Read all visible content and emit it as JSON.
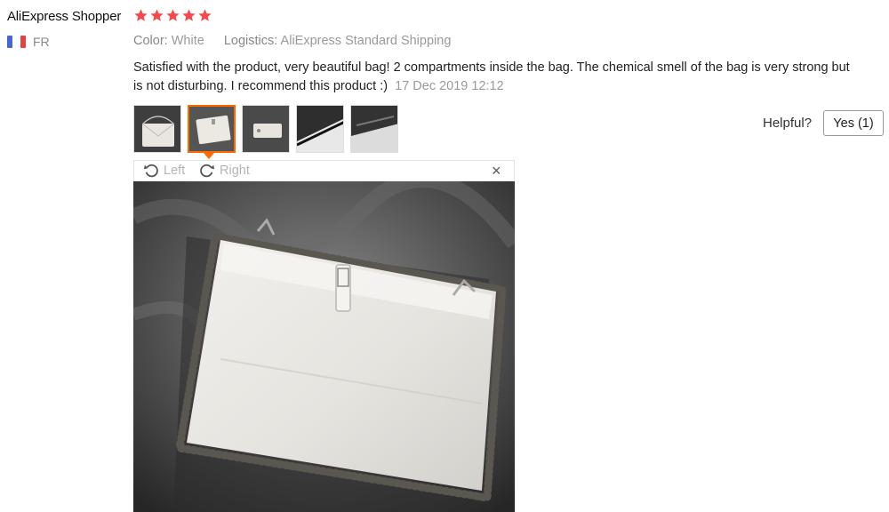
{
  "review": {
    "author": "AliExpress Shopper",
    "rating": 5,
    "country_code": "FR",
    "color_label": "Color:",
    "color_value": "White",
    "logistics_label": "Logistics:",
    "logistics_value": "AliExpress Standard Shipping",
    "text": "Satisfied with the product, very beautiful bag! 2 compartments inside the bag. The chemical smell of the bag is very strong but is not disturbing. I recommend this product :)",
    "date": "17 Dec 2019 12:12"
  },
  "helpful": {
    "label": "Helpful?",
    "yes_label": "Yes (1)"
  },
  "viewer": {
    "rotate_left_label": "Left",
    "rotate_right_label": "Right",
    "close_label": "×",
    "active_thumbnail": 2
  },
  "thumbnails": [
    {
      "index": 1
    },
    {
      "index": 2
    },
    {
      "index": 3
    },
    {
      "index": 4
    },
    {
      "index": 5
    }
  ],
  "colors": {
    "star": "#f5494b",
    "accent": "#ff6a00",
    "muted_text": "#9a9a9a"
  }
}
